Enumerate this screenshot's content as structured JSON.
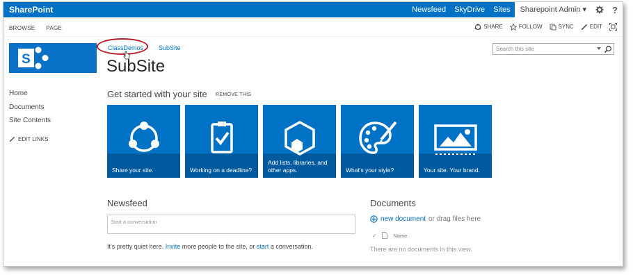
{
  "suitebar": {
    "brand": "SharePoint",
    "links": [
      "Newsfeed",
      "SkyDrive",
      "Sites"
    ],
    "user": "Sharepoint Admin ▾",
    "help": "?"
  },
  "ribbon": {
    "tabs": [
      "BROWSE",
      "PAGE"
    ],
    "actions": [
      "SHARE",
      "FOLLOW",
      "SYNC",
      "EDIT"
    ]
  },
  "breadcrumb": [
    "ClassDemos",
    "SubSite"
  ],
  "site_title": "SubSite",
  "search": {
    "placeholder": "Search this site"
  },
  "leftnav": {
    "items": [
      "Home",
      "Documents",
      "Site Contents"
    ],
    "edit_links": "EDIT LINKS"
  },
  "get_started": {
    "title": "Get started with your site",
    "remove": "REMOVE THIS",
    "tiles": [
      {
        "label": "Share your site.",
        "icon": "share-icon"
      },
      {
        "label": "Working on a deadline?",
        "icon": "clipboard-check-icon"
      },
      {
        "label": "Add lists, libraries, and other apps.",
        "icon": "hexagon-icon"
      },
      {
        "label": "What's your style?",
        "icon": "palette-icon"
      },
      {
        "label": "Your site. Your brand.",
        "icon": "picture-icon"
      }
    ]
  },
  "newsfeed": {
    "title": "Newsfeed",
    "placeholder": "Start a conversation",
    "text_before": "It's pretty quiet here. ",
    "invite": "Invite",
    "text_middle": " more people to the site, or ",
    "start": "start",
    "text_after": " a conversation."
  },
  "documents": {
    "title": "Documents",
    "new_doc": "new document",
    "drag": "or drag files here",
    "col_name": "Name",
    "empty": "There are no documents in this view."
  },
  "colors": {
    "accent": "#0072c6",
    "tile": "#0072c6",
    "tile_band": "#005a9e",
    "highlight": "#b8192a"
  }
}
